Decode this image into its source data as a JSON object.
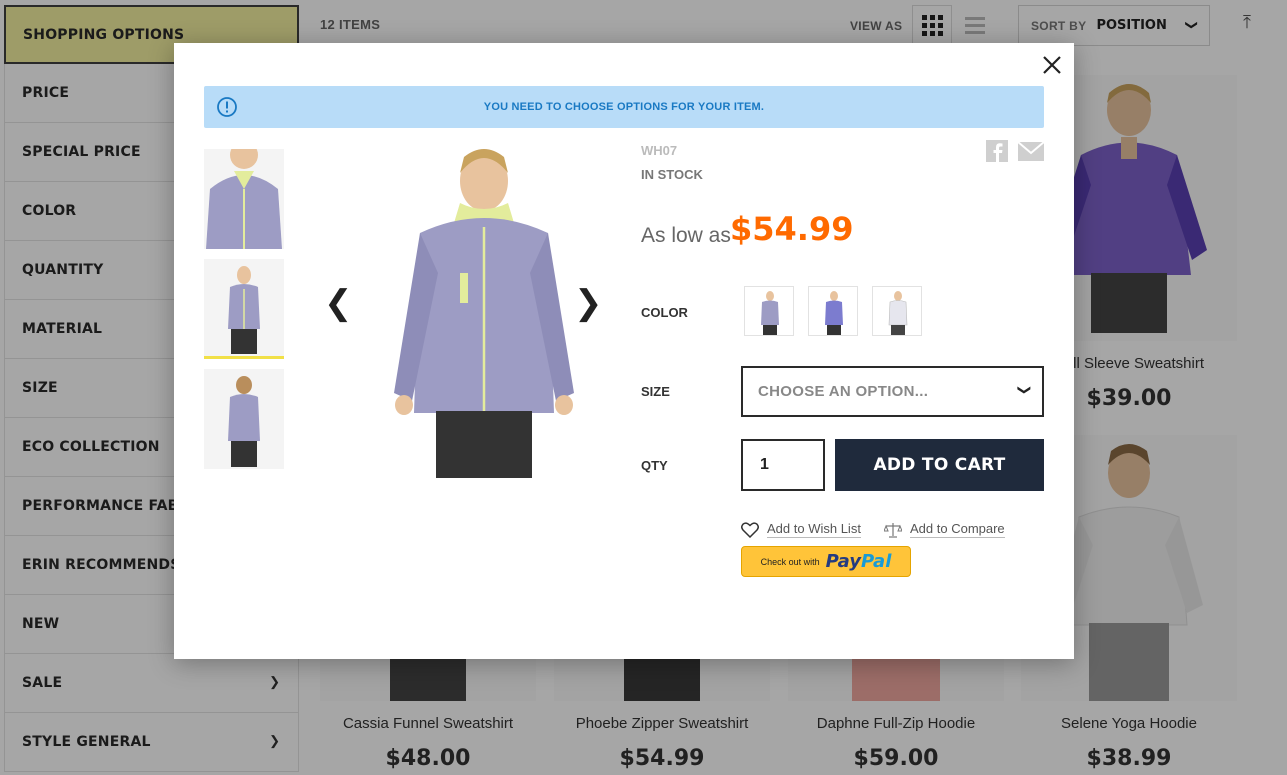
{
  "sidebar": {
    "items": [
      {
        "label": "SHOPPING OPTIONS"
      },
      {
        "label": "PRICE"
      },
      {
        "label": "SPECIAL PRICE"
      },
      {
        "label": "COLOR"
      },
      {
        "label": "QUANTITY"
      },
      {
        "label": "MATERIAL"
      },
      {
        "label": "SIZE"
      },
      {
        "label": "ECO COLLECTION"
      },
      {
        "label": "PERFORMANCE FABRI"
      },
      {
        "label": "ERIN RECOMMENDS"
      },
      {
        "label": "NEW"
      },
      {
        "label": "SALE"
      },
      {
        "label": "STYLE GENERAL"
      }
    ],
    "chevron_icon": "chevron-down-icon"
  },
  "toolbar": {
    "items_count": "12 ITEMS",
    "view_as_label": "VIEW AS",
    "view_grid_icon": "grid-view-icon",
    "view_list_icon": "list-view-icon",
    "sort_label": "SORT BY",
    "sort_value": "POSITION",
    "sort_direction_icon": "sort-arrow-up-icon"
  },
  "products": [
    {
      "name": "Roll Sleeve Sweatshirt",
      "price": "$39.00"
    },
    {
      "name": "Cassia Funnel Sweatshirt",
      "price": "$48.00"
    },
    {
      "name": "Phoebe Zipper Sweatshirt",
      "price": "$54.99"
    },
    {
      "name": "Daphne Full-Zip Hoodie",
      "price": "$59.00"
    },
    {
      "name": "Selene Yoga Hoodie",
      "price": "$38.99"
    }
  ],
  "modal": {
    "notice": "YOU NEED TO CHOOSE OPTIONS FOR YOUR ITEM.",
    "notice_icon": "info-icon",
    "close_icon": "close-icon",
    "sku": "WH07",
    "stock": "IN STOCK",
    "price_prefix": "As low as",
    "price": "$54.99",
    "color_label": "COLOR",
    "size_label": "SIZE",
    "size_placeholder": "CHOOSE AN OPTION...",
    "qty_label": "QTY",
    "qty_value": "1",
    "add_to_cart": "ADD TO CART",
    "wishlist": "Add to Wish List",
    "compare": "Add to Compare",
    "paypal_small": "Check out with",
    "paypal_pay": "Pay",
    "paypal_pal": "Pal",
    "prev_arrow": "❮",
    "next_arrow": "❯",
    "share_icons": [
      "facebook-icon",
      "email-icon"
    ]
  },
  "colors": {
    "accent_orange": "#ff6a00",
    "button_navy": "#1f2a3c",
    "notice_bg": "#b8dcf8",
    "notice_text": "#1979c3",
    "active_filter_bg": "#f3f0a0",
    "thumb_active": "#f1e047"
  }
}
